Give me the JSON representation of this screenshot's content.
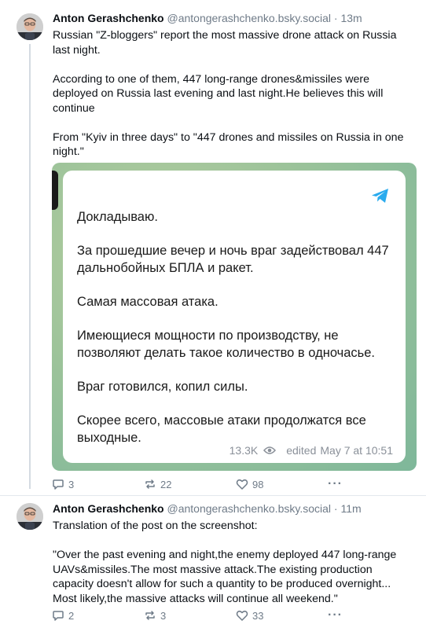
{
  "posts": [
    {
      "author": "Anton Gerashchenko",
      "handle": "@antongerashchenko.bsky.social",
      "separator": "·",
      "time": "13m",
      "paragraphs": [
        "Russian \"Z-bloggers\" report the most massive drone attack on Russia last night.",
        "According to one of them, 447 long-range drones&missiles were deployed on Russia last evening and last night.He believes this will continue",
        "From \"Kyiv in three days\" to \"447 drones and missiles on Russia in one night.\""
      ],
      "embed": {
        "lines": [
          "Докладываю.",
          "За прошедшие вечер и ночь враг задействовал 447 дальнобойных БПЛА и ракет.",
          "Самая массовая атака.",
          "Имеющиеся мощности по производству, не позволяют делать такое количество в одночасье.",
          "Враг готовился, копил силы.",
          "Скорее всего, массовые атаки продолжатся все выходные."
        ],
        "views": "13.3K",
        "edited": "edited",
        "date": "May 7 at 10:51"
      },
      "actions": {
        "replies": "3",
        "reposts": "22",
        "likes": "98",
        "more": "···"
      }
    },
    {
      "author": "Anton Gerashchenko",
      "handle": "@antongerashchenko.bsky.social",
      "separator": "·",
      "time": "11m",
      "paragraphs": [
        "Translation of the post on the screenshot:",
        "\"Over the past evening and night,the enemy deployed 447 long-range UAVs&missiles.The most massive attack.The existing production capacity doesn't allow for such a quantity to be produced overnight... Most likely,the massive attacks will continue all weekend.\""
      ],
      "actions": {
        "replies": "2",
        "reposts": "3",
        "likes": "33",
        "more": "···"
      }
    }
  ],
  "colors": {
    "accent": "#1083fe",
    "muted": "#6f7b88",
    "telegram_blue": "#2AABEE"
  }
}
